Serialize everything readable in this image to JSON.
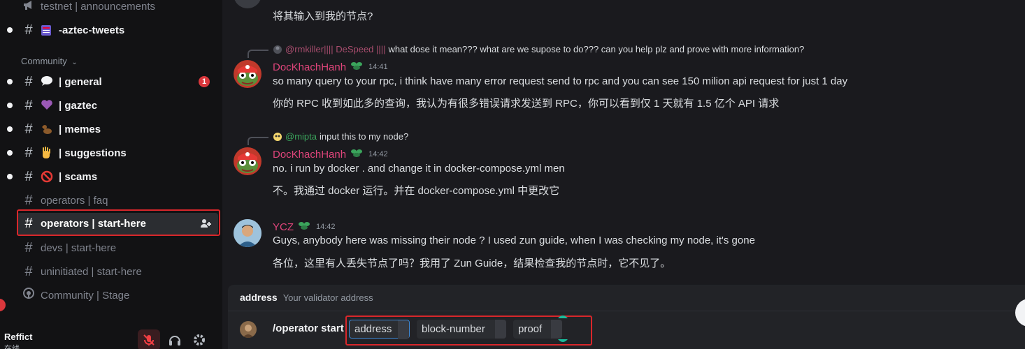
{
  "sidebar": {
    "category": "Community",
    "channels": [
      {
        "label": "testnet | announcements",
        "emoji": "megaphone-icon"
      },
      {
        "label": "-aztec-tweets",
        "emoji": "calendar-icon"
      },
      {
        "label": "| general",
        "emoji": "speech-bubble-icon",
        "badge": "1"
      },
      {
        "label": "| gaztec",
        "emoji": "purple-heart-icon"
      },
      {
        "label": "| memes",
        "emoji": "duck-icon"
      },
      {
        "label": "| suggestions",
        "emoji": "raised-hand-icon"
      },
      {
        "label": "| scams",
        "emoji": "prohibited-icon"
      },
      {
        "label": "operators | faq"
      },
      {
        "label": "operators | start-here"
      },
      {
        "label": "devs | start-here"
      },
      {
        "label": "uninitiated | start-here"
      },
      {
        "label": "Community | Stage"
      }
    ],
    "user": {
      "name": "Reffict",
      "status": "在线"
    }
  },
  "messages": [
    {
      "text": "将其输入到我的节点?"
    },
    {
      "reply_name": "@rmkiller|||| DeSpeed ||||",
      "reply_text": "what dose it mean??? what are we supose to do??? can you help plz and prove with more information?",
      "author": "DocKhachHanh",
      "time": "14:41",
      "text": "so many query to your rpc, i think have many error request send to rpc and you can see 150 milion api request for just 1 day",
      "translation": "你的 RPC 收到如此多的查询，我认为有很多错误请求发送到 RPC，你可以看到仅 1 天就有 1.5 亿个 API 请求"
    },
    {
      "reply_name": "@mipta",
      "reply_text": "input this to my node?",
      "author": "DocKhachHanh",
      "time": "14:42",
      "text": "no. i run by docker . and change it in docker-compose.yml men",
      "translation": "不。我通过 docker 运行。并在 docker-compose.yml 中更改它"
    },
    {
      "author": "YCZ",
      "time": "14:42",
      "text": "Guys, anybody here was missing their node ? I used zun guide, when I was checking my node, it's gone",
      "translation": "各位，这里有人丢失节点了吗？我用了 Zun Guide，结果检查我的节点时，它不见了。"
    }
  ],
  "autocomplete": {
    "option_name": "address",
    "option_desc": "Your validator address",
    "command": "/operator start",
    "options": [
      "address",
      "block-number",
      "proof"
    ]
  },
  "colors": {
    "author_dock": "#e0457b",
    "author_ycz": "#e0457b",
    "reply_mention_a": "#a84d6e",
    "reply_mention_b": "#3ba55c",
    "highlight_red": "#d9272b",
    "badge_red": "#da373c"
  }
}
